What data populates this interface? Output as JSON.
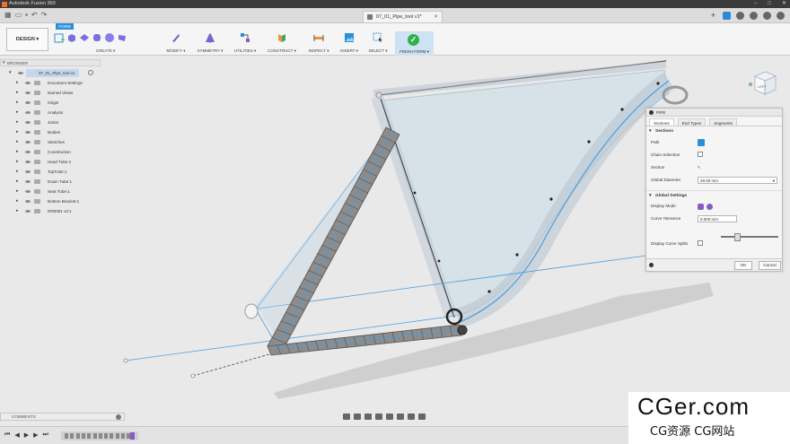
{
  "window": {
    "title": "Autodesk Fusion 360"
  },
  "document_tab": {
    "name": "07_01_Pipe_tool v1*"
  },
  "toolbar": {
    "workspace": "DESIGN ▾",
    "active_tab": "FORM",
    "groups": {
      "create": "CREATE ▾",
      "modify": "MODIFY ▾",
      "symmetry": "SYMMETRY ▾",
      "utilities": "UTILITIES ▾",
      "construct": "CONSTRUCT ▾",
      "inspect": "INSPECT ▾",
      "insert": "INSERT ▾",
      "select": "SELECT ▾",
      "finish": "FINISH FORM ▾"
    }
  },
  "browser": {
    "header": "BROWSER",
    "root": "07_01_Pipe_tool v1",
    "items": [
      {
        "label": "Document Settings"
      },
      {
        "label": "Named Views"
      },
      {
        "label": "Origin"
      },
      {
        "label": "Analysis"
      },
      {
        "label": "Joints"
      },
      {
        "label": "Bodies"
      },
      {
        "label": "Sketches"
      },
      {
        "label": "Construction"
      },
      {
        "label": "Head Tube:1"
      },
      {
        "label": "TopTube:1"
      },
      {
        "label": "Down Tube:1"
      },
      {
        "label": "Seat Tube:1"
      },
      {
        "label": "Bottom Bracket:1"
      },
      {
        "label": "DR0001 v2:1"
      }
    ]
  },
  "pipe_dialog": {
    "title": "PIPE",
    "tabs": {
      "sections": "Sections",
      "end_types": "End Types",
      "segments": "Segments"
    },
    "sections_title": "Sections",
    "path_label": "Path",
    "chain_selection_label": "Chain Selection",
    "section_label": "Section",
    "global_diameter_label": "Global Diameter",
    "global_diameter_value": "28.00 mm",
    "global_settings_title": "Global Settings",
    "display_mode_label": "Display Mode",
    "curve_tolerance_label": "Curve Tolerance",
    "curve_tolerance_value": "0.000 mm",
    "display_curve_splits_label": "Display Curve Splits",
    "ok_label": "OK",
    "cancel_label": "Cancel"
  },
  "viewcube": {
    "face": "LEFT"
  },
  "comments": {
    "label": "COMMENTS"
  },
  "watermark": {
    "big": "CGer.com",
    "small": "CG资源 CG网站"
  },
  "colors": {
    "accent": "#2b8fd8",
    "finish": "#2eb24a",
    "sketch": "#4a9ee0",
    "pipe": "#6e6e6e"
  }
}
